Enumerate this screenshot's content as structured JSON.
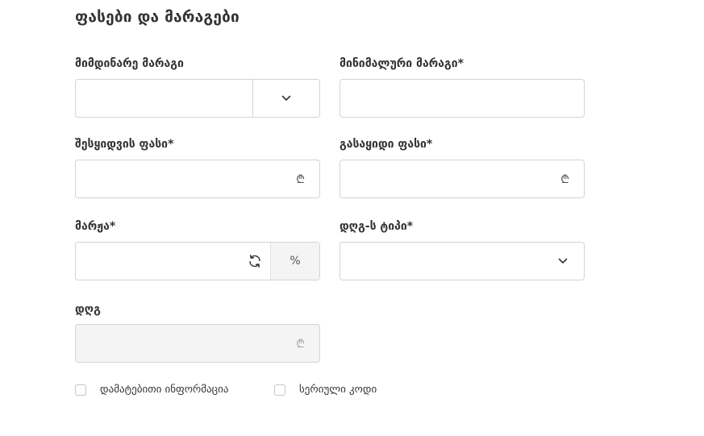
{
  "section": {
    "title": "ფასები და მარაგები"
  },
  "fields": {
    "current_stock": {
      "label": "მიმდინარე მარაგი",
      "value": "",
      "icon": "chevron-down-icon"
    },
    "minimum_stock": {
      "label": "მინიმალური მარაგი*",
      "value": ""
    },
    "purchase_price": {
      "label": "შესყიდვის ფასი*",
      "value": "",
      "currency_symbol": "₾"
    },
    "sale_price": {
      "label": "გასაყიდი ფასი*",
      "value": "",
      "currency_symbol": "₾"
    },
    "margin": {
      "label": "მარჟა*",
      "value": "",
      "icon": "refresh-icon",
      "unit": "%"
    },
    "vat_type": {
      "label": "დღგ-ს ტიპი*",
      "value": "",
      "icon": "chevron-down-icon"
    },
    "vat": {
      "label": "დღგ",
      "value": "",
      "currency_symbol": "₾"
    }
  },
  "checkboxes": {
    "additional_info": {
      "label": "დამატებითი ინფორმაცია",
      "checked": false
    },
    "serial_code": {
      "label": "სერიული კოდი",
      "checked": false
    }
  },
  "colors": {
    "border": "#d4d4d4",
    "disabled_bg": "#f4f4f4",
    "text": "#333333"
  }
}
